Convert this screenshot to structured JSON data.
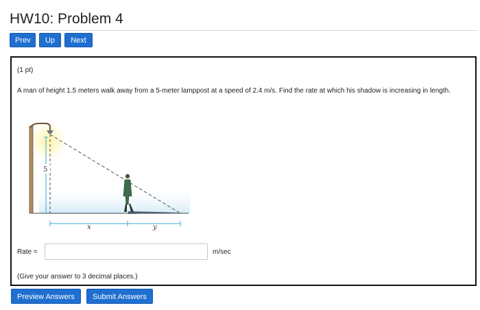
{
  "page": {
    "title": "HW10: Problem 4"
  },
  "nav": {
    "prev_label": "Prev",
    "up_label": "Up",
    "next_label": "Next"
  },
  "problem": {
    "points": "(1 pt)",
    "statement": "A man of height 1.5 meters walk away from a 5-meter lamppost at a speed of 2.4 m/s. Find the rate at which his shadow is increasing in length.",
    "figure": {
      "height_label": "5",
      "x_label": "x",
      "y_label": "y"
    },
    "answer": {
      "label": "Rate =",
      "value": "",
      "unit": "m/sec"
    },
    "hint": "(Give your answer to 3 decimal places.)"
  },
  "actions": {
    "preview_label": "Preview Answers",
    "submit_label": "Submit Answers"
  },
  "colors": {
    "button_blue": "#1f6fd0",
    "dimension_line": "#3aa9d6"
  }
}
